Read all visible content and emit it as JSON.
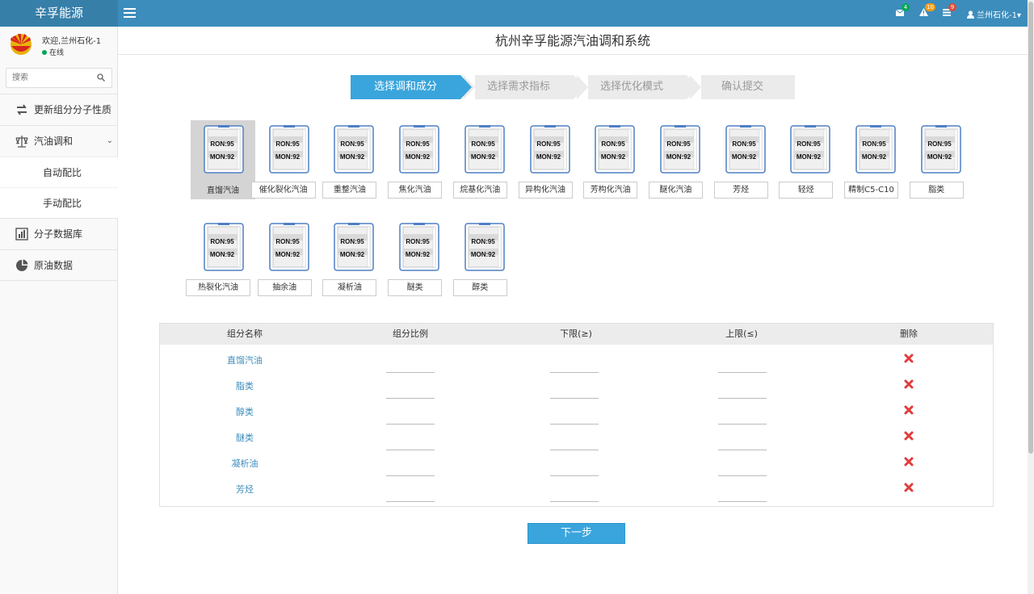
{
  "header": {
    "logo": "辛孚能源",
    "notifications": [
      {
        "icon": "envelope-icon",
        "count": "4",
        "color": "#00a65a"
      },
      {
        "icon": "warning-icon",
        "count": "10",
        "color": "#f39c12"
      },
      {
        "icon": "tasks-icon",
        "count": "9",
        "color": "#dd4b39"
      }
    ],
    "user": "兰州石化-1"
  },
  "sidebar": {
    "welcome": "欢迎,兰州石化-1",
    "status": "在线",
    "search_placeholder": "搜索",
    "items": [
      {
        "label": "更新组分分子性质",
        "icon": "exchange-icon"
      },
      {
        "label": "汽油调和",
        "icon": "balance-scale-icon"
      },
      {
        "label": "自动配比"
      },
      {
        "label": "手动配比"
      },
      {
        "label": "分子数据库",
        "icon": "bar-chart-icon"
      },
      {
        "label": "原油数据",
        "icon": "pie-chart-icon"
      }
    ]
  },
  "page_title": "杭州辛孚能源汽油调和系统",
  "wizard": {
    "steps": [
      "选择调和成分",
      "选择需求指标",
      "选择优化模式",
      "确认提交"
    ],
    "active": 0
  },
  "tile_text": {
    "ron": "RON:95",
    "mon": "MON:92"
  },
  "components": [
    "直馏汽油",
    "催化裂化汽油",
    "重整汽油",
    "焦化汽油",
    "烷基化汽油",
    "异构化汽油",
    "芳构化汽油",
    "醚化汽油",
    "芳烃",
    "轻烃",
    "精制C5-C10",
    "脂类",
    "热裂化汽油",
    "抽余油",
    "凝析油",
    "醚类",
    "醇类"
  ],
  "table": {
    "headers": [
      "组分名称",
      "组分比例",
      "下限(≥)",
      "上限(≤)",
      "删除"
    ],
    "rows": [
      "直馏汽油",
      "脂类",
      "醇类",
      "醚类",
      "凝析油",
      "芳烃"
    ]
  },
  "next_button": "下一步"
}
